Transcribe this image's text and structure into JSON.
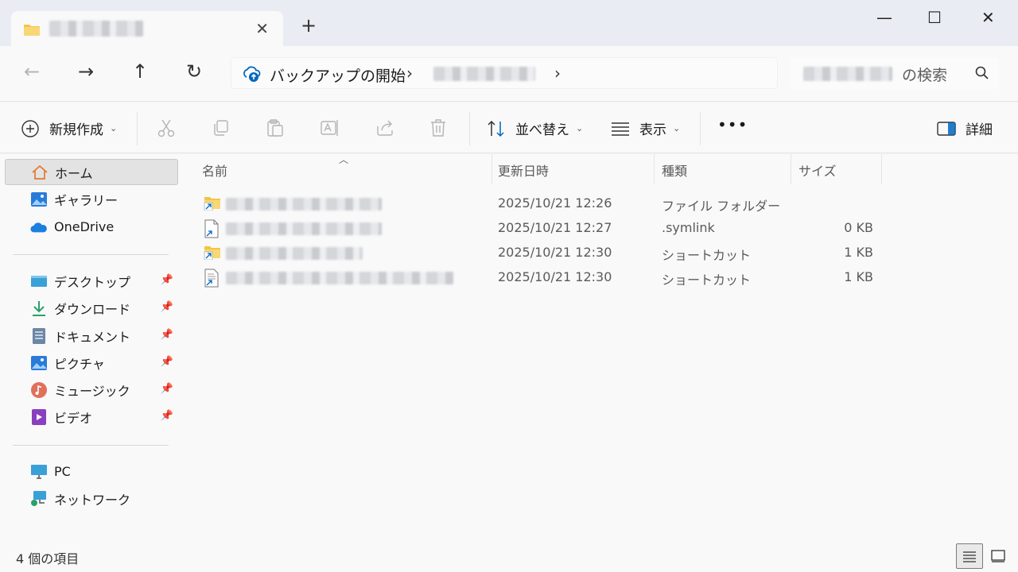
{
  "tab": {
    "close_glyph": "✕"
  },
  "new_tab_glyph": "+",
  "window": {
    "minimize": "—",
    "maximize": "☐",
    "close": "✕"
  },
  "nav": {
    "back": "←",
    "forward": "→",
    "up": "↑",
    "refresh": "↻"
  },
  "address": {
    "crumb1": "バックアップの開始",
    "separator": "›"
  },
  "search": {
    "placeholder_suffix": "の検索"
  },
  "commands": {
    "new": "新規作成",
    "sort": "並べ替え",
    "view": "表示",
    "more": "•••",
    "details": "詳細"
  },
  "sidebar": {
    "home": "ホーム",
    "gallery": "ギャラリー",
    "onedrive": "OneDrive",
    "desktop": "デスクトップ",
    "downloads": "ダウンロード",
    "documents": "ドキュメント",
    "pictures": "ピクチャ",
    "music": "ミュージック",
    "videos": "ビデオ",
    "pc": "PC",
    "network": "ネットワーク"
  },
  "columns": {
    "name": "名前",
    "modified": "更新日時",
    "type": "種類",
    "size": "サイズ"
  },
  "files": [
    {
      "icon": "folder-link-icon",
      "date": "2025/10/21 12:26",
      "type": "ファイル フォルダー",
      "size": ""
    },
    {
      "icon": "symlink-file-icon",
      "date": "2025/10/21 12:27",
      "type": ".symlink",
      "size": "0 KB"
    },
    {
      "icon": "folder-shortcut-icon",
      "date": "2025/10/21 12:30",
      "type": "ショートカット",
      "size": "1 KB"
    },
    {
      "icon": "document-shortcut-icon",
      "date": "2025/10/21 12:30",
      "type": "ショートカット",
      "size": "1 KB"
    }
  ],
  "status": {
    "count": "4 個の項目"
  },
  "colors": {
    "accent": "#0067c0",
    "folder": "#f4c542",
    "selected_bg": "#e3e3e3"
  }
}
